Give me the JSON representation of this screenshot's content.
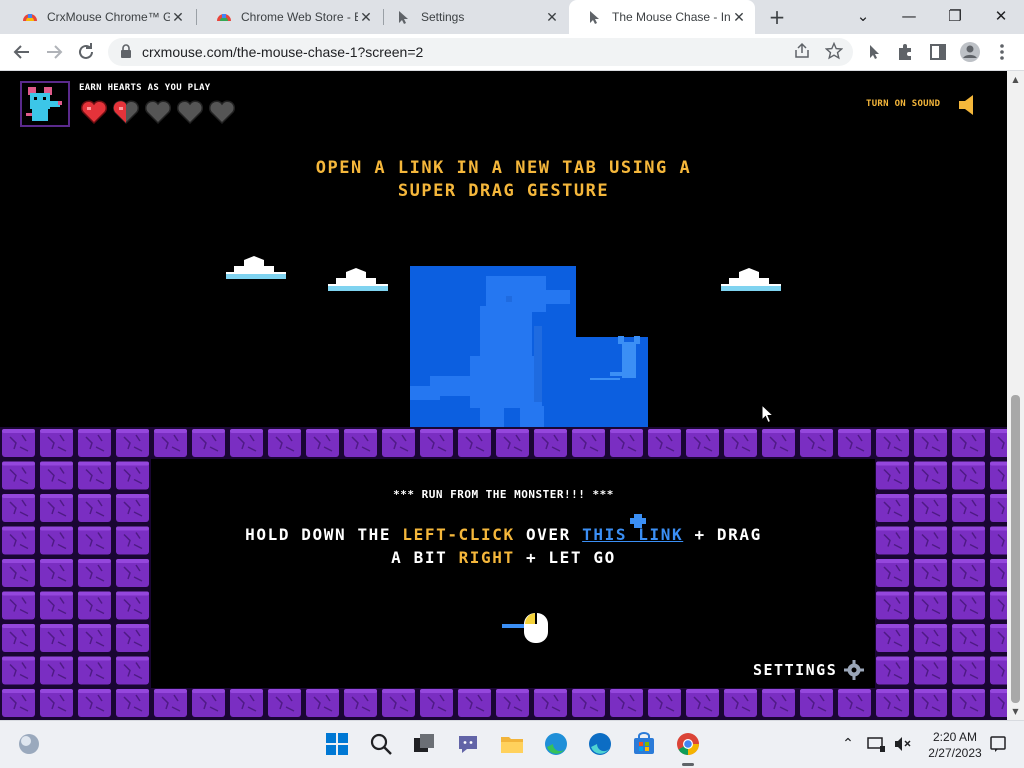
{
  "browser": {
    "tabs": [
      {
        "title": "CrxMouse Chrome™ G",
        "icon": "crxmouse-icon"
      },
      {
        "title": "Chrome Web Store - E",
        "icon": "webstore-icon"
      },
      {
        "title": "Settings",
        "icon": "settings-gesture-icon"
      },
      {
        "title": "The Mouse Chase - Int",
        "icon": "gesture-arrow-icon",
        "active": true
      }
    ],
    "close_glyph": "✕",
    "new_tab_glyph": "+",
    "window_controls": {
      "dropdown": "⌄",
      "minimize": "—",
      "restore": "❐",
      "close": "✕"
    },
    "url": "crxmouse.com/the-mouse-chase-1?screen=2"
  },
  "page": {
    "earn_label": "EARN HEARTS AS YOU PLAY",
    "hearts": {
      "full": 1,
      "half": 1,
      "empty": 3,
      "total": 5
    },
    "sound_label": "TURN ON SOUND",
    "headline_line1": "OPEN A LINK IN A NEW TAB USING A",
    "headline_line2": "SUPER DRAG GESTURE",
    "run_label": "*** RUN FROM THE MONSTER!!! ***",
    "instr_hold": "HOLD DOWN THE ",
    "instr_leftclick": "LEFT-CLICK",
    "instr_over": " OVER ",
    "instr_link": "THIS LINK",
    "instr_plus_drag": " + DRAG",
    "instr_bit": "A BIT ",
    "instr_right": "RIGHT",
    "instr_letgo": " + LET GO",
    "settings_label": "SETTINGS",
    "colors": {
      "accent_yellow": "#f5b73b",
      "link_blue": "#3b8ff5",
      "wall_purple": "#7a2ec2",
      "selection_blue": "#0c5fe0"
    }
  },
  "taskbar": {
    "time": "2:20 AM",
    "date": "2/27/2023",
    "icons": [
      "widgets-icon",
      "start-icon",
      "search-icon",
      "task-view-icon",
      "chat-icon",
      "file-explorer-icon",
      "edge-icon",
      "edge-beta-icon",
      "store-icon",
      "chrome-icon"
    ]
  }
}
